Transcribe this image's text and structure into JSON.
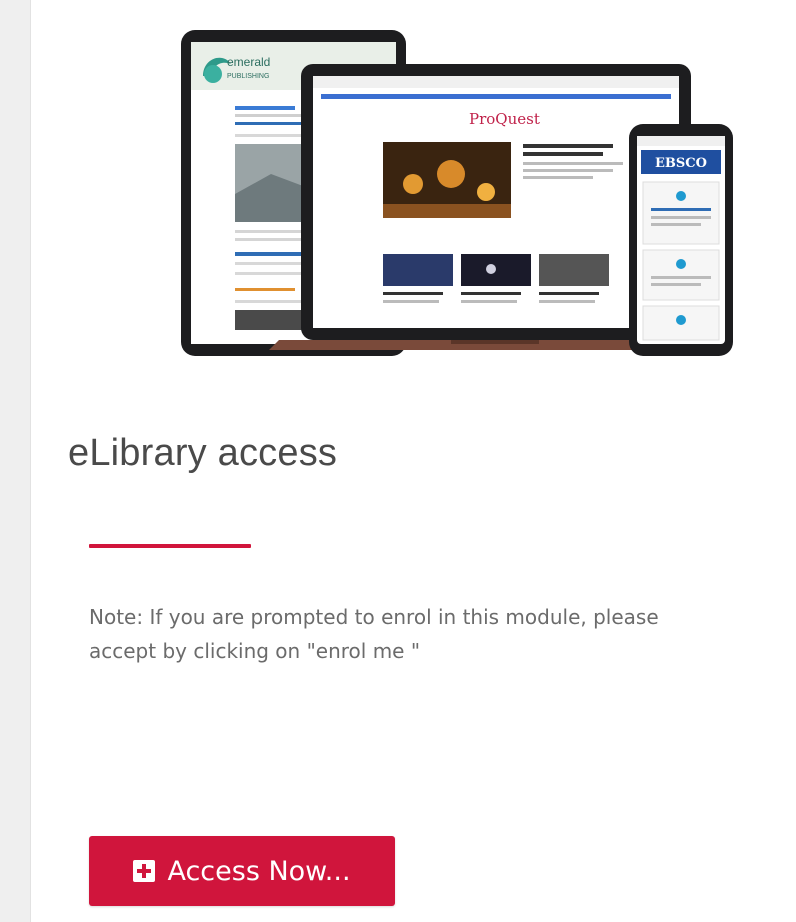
{
  "hero": {
    "publisher_brand": "emerald PUBLISHING",
    "database_brand": "ProQuest",
    "mobile_brand": "EBSCO"
  },
  "card": {
    "title": "eLibrary access",
    "note_line1": "Note: If you are prompted to enrol in this module, please",
    "note_line2": "accept by clicking on \"enrol me \"",
    "button_label": "Access Now..."
  },
  "colors": {
    "accent": "#d0153c",
    "title_text": "#4a4a4a",
    "note_text": "#6b6b6b"
  },
  "icons": {
    "button_icon": "plus-square-icon"
  }
}
